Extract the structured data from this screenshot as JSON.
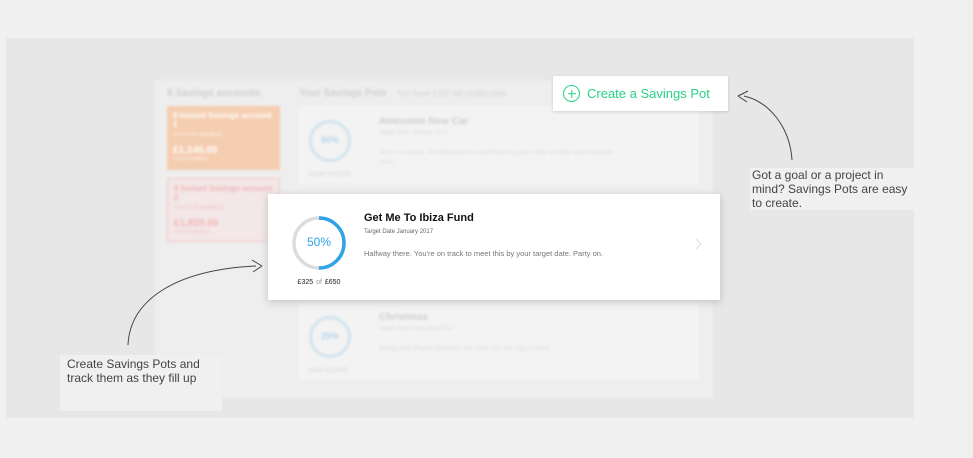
{
  "background": {
    "accounts_heading": "8 Savings accounts",
    "pots_heading": "Your Savings Pots",
    "pots_subheading": "You have £320 left unallocated",
    "accounts": [
      {
        "title": "8 Instant Savings account 1",
        "number": "10-00-09  #864821",
        "balance": "£1,140.00",
        "balance_label": "Current balance"
      },
      {
        "title": "8 Instant Savings account 2",
        "number": "10-00-09  #864822",
        "balance": "£1,820.00",
        "balance_label": "Current balance"
      }
    ],
    "pots": [
      {
        "name": "Awesome New Car",
        "target": "Target Date January 2017",
        "message": "You're on course. One final push this month and it's yours. Why not drop some money in now?",
        "percent": "80%",
        "amount": "£1640 of £2100"
      },
      {
        "name": "Christmas",
        "target": "Target Date December 2017",
        "message": "Strong start! Regular payments will make sure you stay on track.",
        "percent": "25%",
        "amount": "£625 of £2600"
      }
    ]
  },
  "create_button": {
    "label": "Create a Savings Pot",
    "icon": "plus-circle-icon"
  },
  "focus_pot": {
    "percent_label": "50%",
    "progress": 0.5,
    "amount_saved": "£325",
    "amount_of": "of",
    "amount_target": "£650",
    "title": "Get Me To Ibiza Fund",
    "target_date": "Target Date January 2017",
    "message": "Halfway there. You're on track to meet this by your target date. Party on.",
    "chevron_icon": "chevron-right-icon"
  },
  "callouts": {
    "right": "Got a goal or a project in mind? Savings Pots are easy to create.",
    "left": "Create Savings Pots and track them as they fill up"
  },
  "colors": {
    "accent_green": "#27d086",
    "progress_blue": "#2ea3e6",
    "ring_track": "#dcdcdc"
  }
}
